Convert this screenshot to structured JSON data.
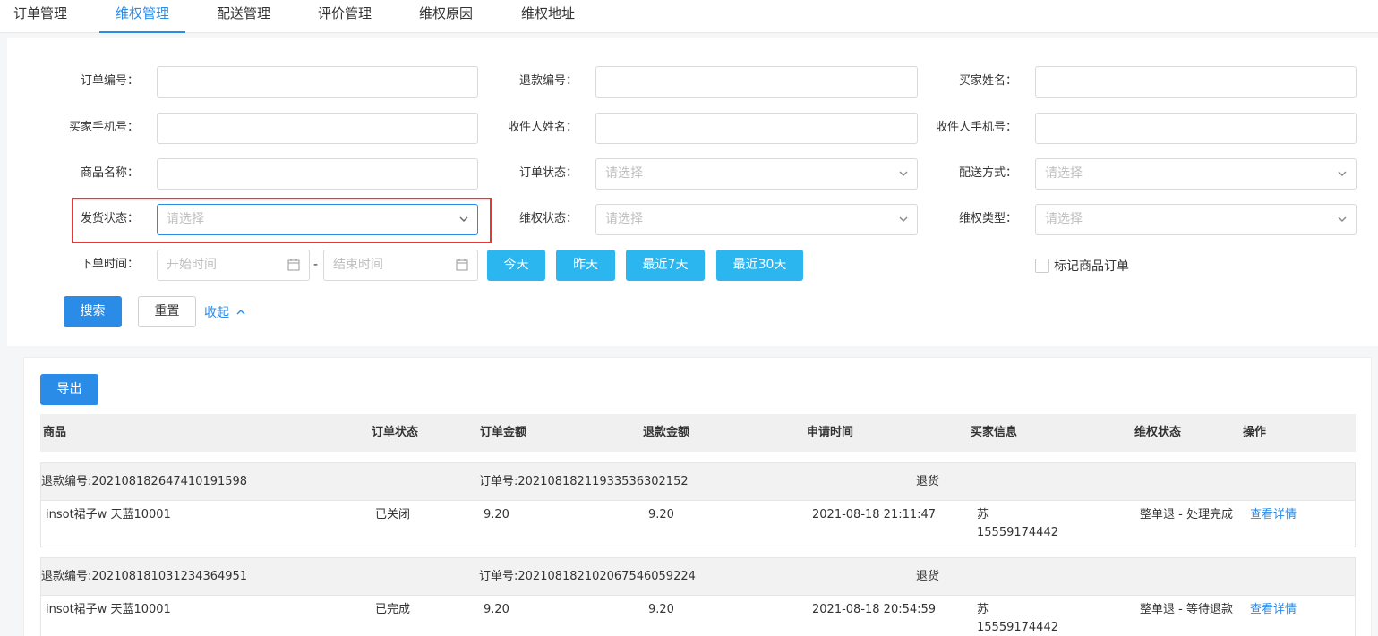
{
  "tabs": [
    "订单管理",
    "维权管理",
    "配送管理",
    "评价管理",
    "维权原因",
    "维权地址"
  ],
  "active_tab": "维权管理",
  "filters": {
    "order_no": "订单编号：",
    "refund_no": "退款编号：",
    "buyer_name": "买家姓名：",
    "buyer_phone": "买家手机号：",
    "receiver_name": "收件人姓名：",
    "receiver_phone": "收件人手机号：",
    "product_name": "商品名称：",
    "order_status": "订单状态：",
    "delivery_method": "配送方式：",
    "ship_status": "发货状态：",
    "rights_status": "维权状态：",
    "rights_type": "维权类型：",
    "order_time": "下单时间：",
    "select_placeholder": "请选择",
    "start_time_placeholder": "开始时间",
    "end_time_placeholder": "结束时间",
    "dash": "-"
  },
  "quick_buttons": [
    "今天",
    "昨天",
    "最近7天",
    "最近30天"
  ],
  "mark_checkbox_label": "标记商品订单",
  "actions": {
    "search": "搜索",
    "reset": "重置",
    "collapse": "收起"
  },
  "export_label": "导出",
  "table_headers": [
    "商品",
    "订单状态",
    "订单金额",
    "退款金额",
    "申请时间",
    "买家信息",
    "维权状态",
    "操作"
  ],
  "orders": [
    {
      "refund_no": "退款编号:202108182647410191598",
      "order_no": "订单号:20210818211933536302152",
      "type": "退货",
      "product": "insot裙子w 天蓝10001",
      "status": "已关闭",
      "order_amount": "9.20",
      "refund_amount": "9.20",
      "apply_time": "2021-08-18 21:11:47",
      "buyer_name": "苏",
      "buyer_phone": "15559174442",
      "rights_status": "整单退 - 处理完成",
      "action": "查看详情"
    },
    {
      "refund_no": "退款编号:202108181031234364951",
      "order_no": "订单号:20210818210206754605922 4",
      "type": "退货",
      "product": "insot裙子w 天蓝10001",
      "status": "已完成",
      "order_amount": "9.20",
      "refund_amount": "9.20",
      "apply_time": "2021-08-18 20:54:59",
      "buyer_name": "苏",
      "buyer_phone": "15559174442",
      "rights_status": "整单退 - 等待退款",
      "action": "查看详情"
    }
  ]
}
